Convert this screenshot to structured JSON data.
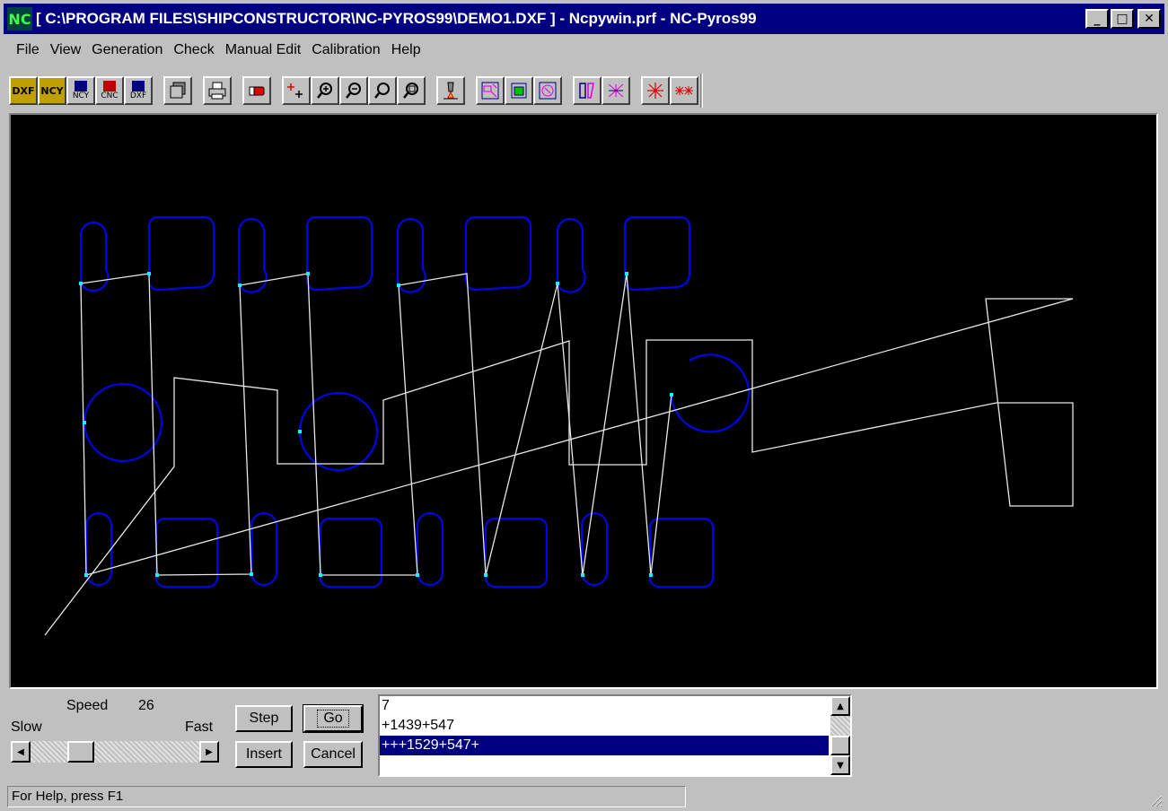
{
  "window": {
    "title": "[ C:\\PROGRAM FILES\\SHIPCONSTRUCTOR\\NC-PYROS99\\DEMO1.DXF ] - Ncpywin.prf - NC-Pyros99",
    "icon": "NC",
    "minimize": "_",
    "maximize": "□",
    "close": "✕"
  },
  "menu": [
    "File",
    "View",
    "Generation",
    "Check",
    "Manual Edit",
    "Calibration",
    "Help"
  ],
  "toolbar": {
    "open_dxf": "DXF",
    "open_ncy": "NCY",
    "save_ncy": "NCY",
    "save_cnc": "CNC",
    "save_dxf": "DXF",
    "icons": [
      "copy-icon",
      "print-icon",
      "eraser-icon",
      "add-point-icon",
      "zoom-in-icon",
      "zoom-out-icon",
      "zoom-window-icon",
      "zoom-all-icon",
      "torch-icon",
      "layout-icon",
      "part-icon",
      "rotate-icon",
      "mirror-icon",
      "intersect-icon",
      "marker-icon",
      "multi-marker-icon"
    ]
  },
  "controls": {
    "speed_label": "Speed",
    "speed_value": "26",
    "slow_label": "Slow",
    "fast_label": "Fast",
    "speed_position": 0.26,
    "step": "Step",
    "go": "Go",
    "insert": "Insert",
    "cancel": "Cancel"
  },
  "list": {
    "rows": [
      "7",
      "+1439+547",
      "+++1529+547+"
    ],
    "selected_index": 2
  },
  "status": {
    "text": "For Help, press F1"
  },
  "colors": {
    "title_bar": "#000080",
    "canvas_bg": "#000000",
    "part_outline": "#0000ff",
    "tool_path": "#e8e8e8",
    "pierce_point": "#00ffff"
  }
}
